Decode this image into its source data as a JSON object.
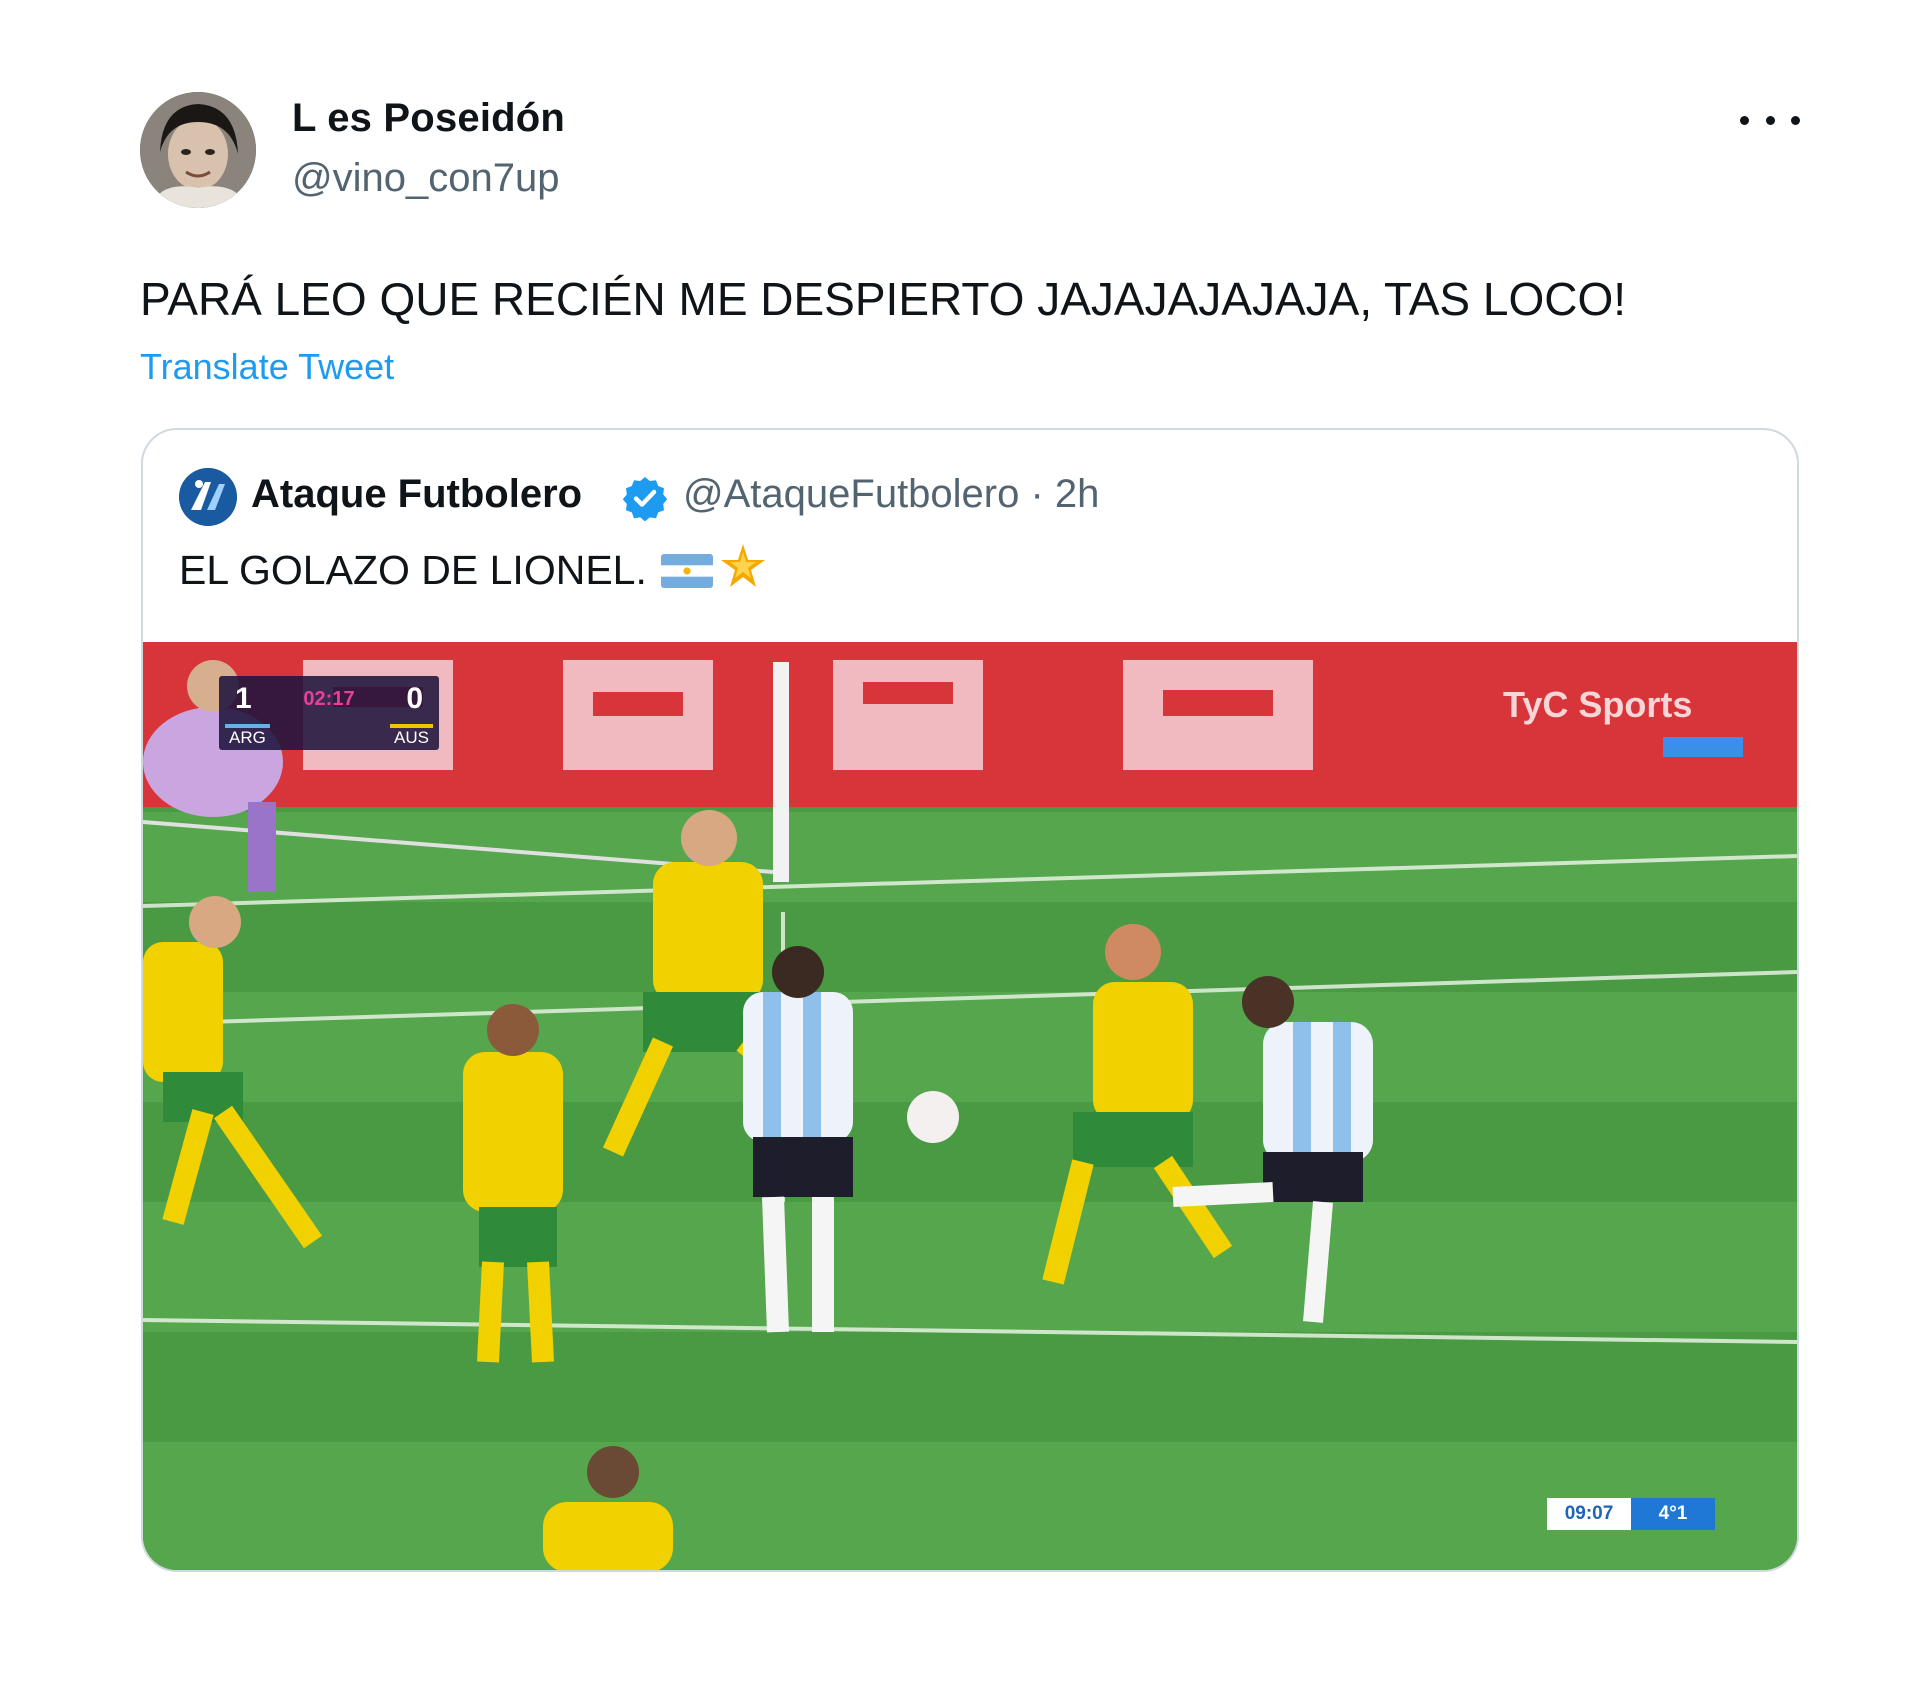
{
  "author": {
    "name": "L es Poseidón",
    "handle": "@vino_con7up"
  },
  "tweet": {
    "text": "PARÁ LEO QUE RECIÉN ME DESPIERTO JAJAJAJAJAJA, TAS LOCO!",
    "translate_label": "Translate Tweet"
  },
  "more_icon": "ellipsis-icon",
  "quote": {
    "name": "Ataque Futbolero",
    "verified_icon": "verified-badge-icon",
    "handle_time": "@AtaqueFutbolero · 2h",
    "text": "EL GOLAZO DE LIONEL.",
    "emojis": [
      "argentina-flag-icon",
      "star-icon"
    ]
  },
  "media": {
    "scorebug": {
      "home_score": "1",
      "away_score": "0",
      "match_time": "02:17",
      "home_team": "ARG",
      "away_team": "AUS"
    },
    "broadcaster": "TyC Sports",
    "clock": {
      "time": "09:07",
      "value": "4°1"
    }
  },
  "colors": {
    "link": "#1d9bf0",
    "secondary_text": "#536471",
    "border": "#cfd9de",
    "verified": "#1d9bf0"
  }
}
